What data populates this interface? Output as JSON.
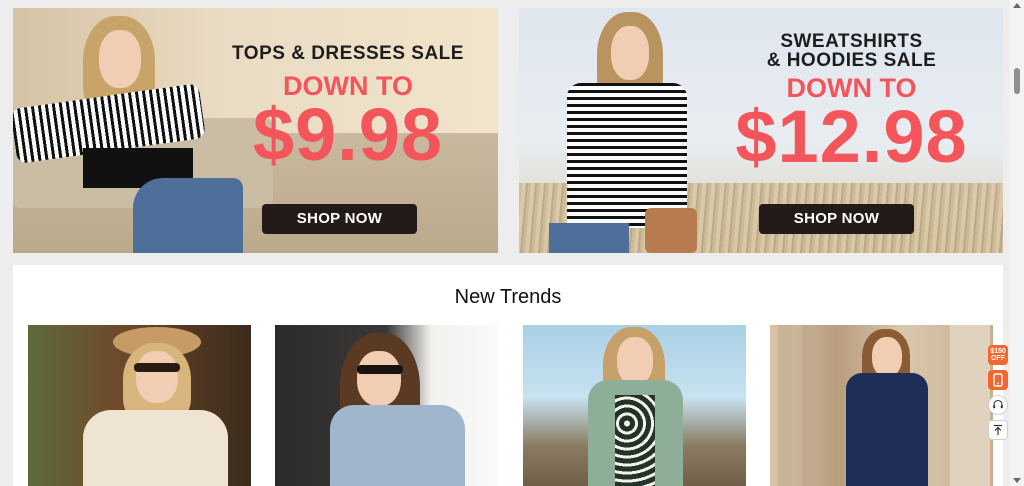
{
  "banners": [
    {
      "title": "TOPS & DRESSES SALE",
      "subtitle": "DOWN TO",
      "price": "$9.98",
      "button": "SHOP NOW"
    },
    {
      "title_line1": "SWEATSHIRTS",
      "title_line2": "& HOODIES SALE",
      "subtitle": "DOWN TO",
      "price": "$12.98",
      "button": "SHOP NOW"
    }
  ],
  "section": {
    "title": "New Trends"
  },
  "products": [
    {
      "name": "corduroy-jacket-hat-model"
    },
    {
      "name": "blue-wrap-knit-top-model"
    },
    {
      "name": "floral-dress-cardigan-model"
    },
    {
      "name": "navy-lace-dress-model"
    }
  ],
  "side_tools": {
    "coupon_amount": "$150",
    "coupon_label": "OFF",
    "icons": [
      "coupon-icon",
      "mobile-app-icon",
      "customer-service-icon",
      "back-to-top-icon"
    ]
  },
  "colors": {
    "sale_accent": "#f2555a",
    "button_bg": "#231a1a",
    "tool_accent": "#f2672f"
  }
}
